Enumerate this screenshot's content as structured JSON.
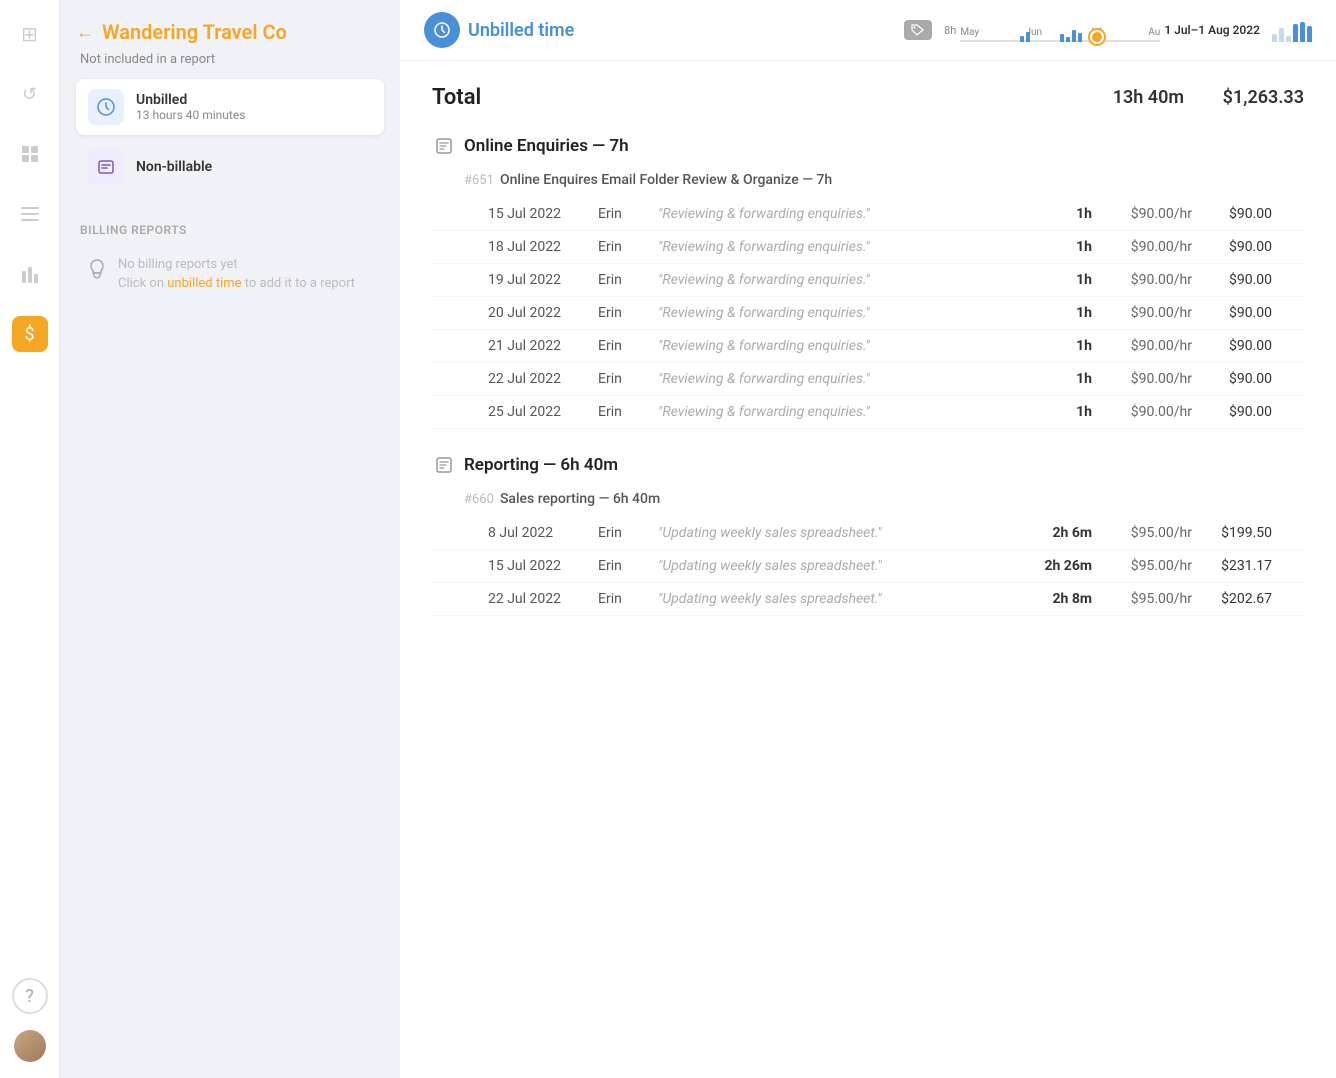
{
  "nav": {
    "icons": [
      {
        "name": "grid-icon",
        "symbol": "⊞",
        "active": false
      },
      {
        "name": "clock-icon",
        "symbol": "↺",
        "active": false
      },
      {
        "name": "table-icon",
        "symbol": "▦",
        "active": false
      },
      {
        "name": "list-icon",
        "symbol": "☰",
        "active": false
      },
      {
        "name": "bar-chart-icon",
        "symbol": "▮",
        "active": false
      },
      {
        "name": "dollar-icon",
        "symbol": "$",
        "active": true
      }
    ],
    "bottom": [
      {
        "name": "help-icon",
        "symbol": "?"
      },
      {
        "name": "avatar-icon",
        "symbol": ""
      }
    ]
  },
  "sidebar": {
    "back_label": "←",
    "client_name": "Wandering Travel Co",
    "not_included_label": "Not included in a report",
    "unbilled": {
      "label": "Unbilled",
      "sublabel": "13 hours 40 minutes"
    },
    "nonbillable": {
      "label": "Non-billable"
    },
    "billing_reports_label": "Billing reports",
    "no_reports_label": "No billing reports yet",
    "no_reports_hint": "Click on unbilled time to add it to a report"
  },
  "topbar": {
    "badge_label": "Unbilled time",
    "date_range": "1 Jul–1 Aug 2022",
    "timeline_hours": "8h",
    "months": [
      "May",
      "Jun",
      "Jul",
      "Au"
    ],
    "mini_bars": [
      4,
      8,
      12,
      16,
      14,
      10,
      18,
      20,
      16
    ]
  },
  "main": {
    "total_label": "Total",
    "total_time": "13h 40m",
    "total_amount": "$1,263.33",
    "projects": [
      {
        "name": "Online Enquiries — 7h",
        "tasks": [
          {
            "number": "#651",
            "name": "Online Enquires Email Folder Review & Organize — 7h",
            "entries": [
              {
                "date": "15 Jul 2022",
                "person": "Erin",
                "note": "\"Reviewing & forwarding enquiries.\"",
                "duration": "1h",
                "rate": "$90.00/hr",
                "amount": "$90.00"
              },
              {
                "date": "18 Jul 2022",
                "person": "Erin",
                "note": "\"Reviewing & forwarding enquiries.\"",
                "duration": "1h",
                "rate": "$90.00/hr",
                "amount": "$90.00"
              },
              {
                "date": "19 Jul 2022",
                "person": "Erin",
                "note": "\"Reviewing & forwarding enquiries.\"",
                "duration": "1h",
                "rate": "$90.00/hr",
                "amount": "$90.00"
              },
              {
                "date": "20 Jul 2022",
                "person": "Erin",
                "note": "\"Reviewing & forwarding enquiries.\"",
                "duration": "1h",
                "rate": "$90.00/hr",
                "amount": "$90.00"
              },
              {
                "date": "21 Jul 2022",
                "person": "Erin",
                "note": "\"Reviewing & forwarding enquiries.\"",
                "duration": "1h",
                "rate": "$90.00/hr",
                "amount": "$90.00"
              },
              {
                "date": "22 Jul 2022",
                "person": "Erin",
                "note": "\"Reviewing & forwarding enquiries.\"",
                "duration": "1h",
                "rate": "$90.00/hr",
                "amount": "$90.00"
              },
              {
                "date": "25 Jul 2022",
                "person": "Erin",
                "note": "\"Reviewing & forwarding enquiries.\"",
                "duration": "1h",
                "rate": "$90.00/hr",
                "amount": "$90.00"
              }
            ]
          }
        ]
      },
      {
        "name": "Reporting — 6h 40m",
        "tasks": [
          {
            "number": "#660",
            "name": "Sales reporting — 6h 40m",
            "entries": [
              {
                "date": "8 Jul 2022",
                "person": "Erin",
                "note": "\"Updating weekly sales spreadsheet.\"",
                "duration": "2h 6m",
                "rate": "$95.00/hr",
                "amount": "$199.50"
              },
              {
                "date": "15 Jul 2022",
                "person": "Erin",
                "note": "\"Updating weekly sales spreadsheet.\"",
                "duration": "2h 26m",
                "rate": "$95.00/hr",
                "amount": "$231.17"
              },
              {
                "date": "22 Jul 2022",
                "person": "Erin",
                "note": "\"Updating weekly sales spreadsheet.\"",
                "duration": "2h 8m",
                "rate": "$95.00/hr",
                "amount": "$202.67"
              }
            ]
          }
        ]
      }
    ]
  }
}
